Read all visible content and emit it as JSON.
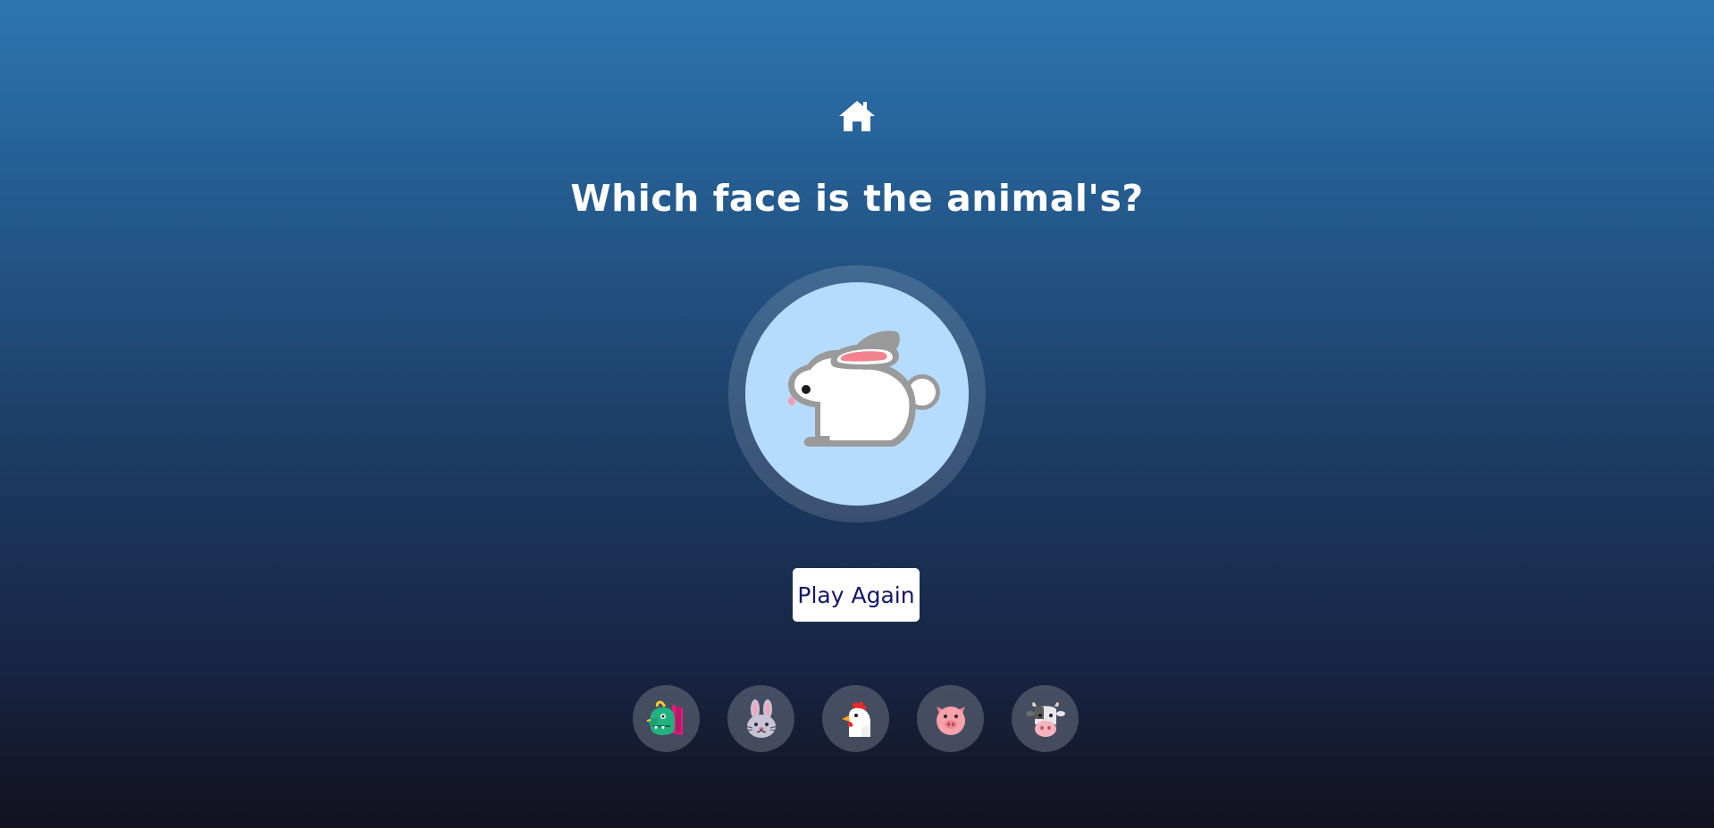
{
  "header": {
    "home_icon": "home-icon"
  },
  "question": {
    "title": "Which face is the animal's?"
  },
  "target": {
    "animal": "rabbit",
    "icon": "rabbit-icon"
  },
  "actions": {
    "play_again_label": "Play Again"
  },
  "choices": [
    {
      "animal": "dragon",
      "icon": "dragon-face-icon"
    },
    {
      "animal": "rabbit",
      "icon": "rabbit-face-icon"
    },
    {
      "animal": "chicken",
      "icon": "chicken-face-icon"
    },
    {
      "animal": "pig",
      "icon": "pig-face-icon"
    },
    {
      "animal": "cow",
      "icon": "cow-face-icon"
    }
  ],
  "colors": {
    "background_top": "#2c76b2",
    "background_bottom": "#13111f",
    "target_circle": "#b6dcfd",
    "button_text": "#14166b"
  }
}
